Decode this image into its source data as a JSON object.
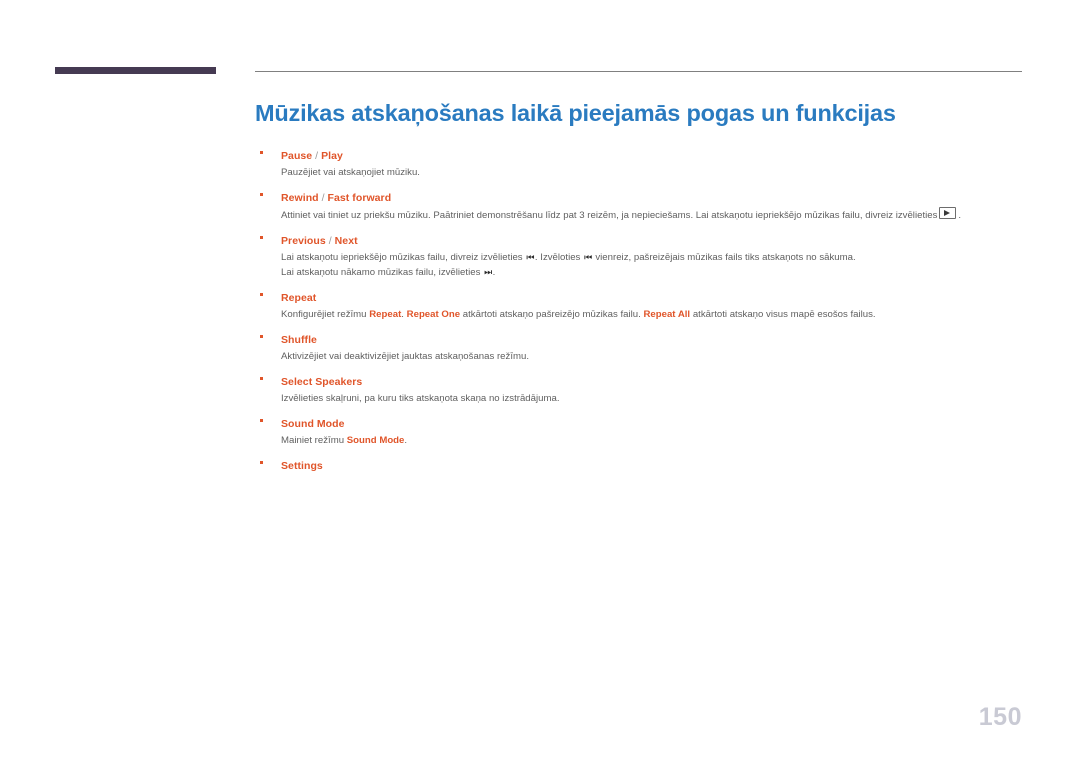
{
  "page": {
    "title": "Mūzikas atskaņošanas laikā pieejamās pogas un funkcijas",
    "number": "150",
    "accent_blue": "#2a7bc0",
    "accent_orange": "#e0552a",
    "tab_color": "#453a52",
    "body_text_color": "#5f5f5f",
    "page_number_color": "#c9cad4"
  },
  "items": [
    {
      "label_main": "Pause",
      "label_sep": " / ",
      "label_alt": "Play",
      "desc_1": "Pauzējiet vai atskaņojiet mūziku."
    },
    {
      "label_main": "Rewind",
      "label_sep": " / ",
      "label_alt": "Fast forward",
      "desc_1a": "Attiniet vai tiniet uz priekšu mūziku. Paātriniet demonstrēšanu līdz pat 3 reizēm, ja nepieciešams. Lai atskaņotu iepriekšējo mūzikas failu, divreiz izvēlieties",
      "desc_1b": ".",
      "icon_1": "play-button-icon"
    },
    {
      "label_main": "Previous",
      "label_sep": " / ",
      "label_alt": "Next",
      "desc_1a": "Lai atskaņotu iepriekšējo mūzikas failu, divreiz izvēlieties",
      "desc_1b": ". Izvēloties",
      "desc_1c": "vienreiz, pašreizējais mūzikas fails tiks atskaņots no sākuma.",
      "icon_prev_1": "previous-track-icon",
      "icon_prev_2": "previous-track-icon",
      "desc_2a": "Lai atskaņotu nākamo mūzikas failu, izvēlieties",
      "desc_2b": ".",
      "icon_next": "next-track-icon"
    },
    {
      "label_main": "Repeat",
      "desc_1a": "Konfigurējiet režīmu",
      "hl_1": "Repeat",
      "desc_1b": ".",
      "hl_2": "Repeat One",
      "desc_1c": "atkārtoti atskaņo pašreizējo mūzikas failu.",
      "hl_3": "Repeat All",
      "desc_1d": "atkārtoti atskaņo visus mapē esošos failus."
    },
    {
      "label_main": "Shuffle",
      "desc_1": "Aktivizējiet vai deaktivizējiet jauktas atskaņošanas režīmu."
    },
    {
      "label_main": "Select Speakers",
      "desc_1": "Izvēlieties skaļruni, pa kuru tiks atskaņota skaņa no izstrādājuma."
    },
    {
      "label_main": "Sound Mode",
      "desc_1a": "Mainiet režīmu",
      "hl_1": "Sound Mode",
      "desc_1b": "."
    },
    {
      "label_main": "Settings"
    }
  ]
}
